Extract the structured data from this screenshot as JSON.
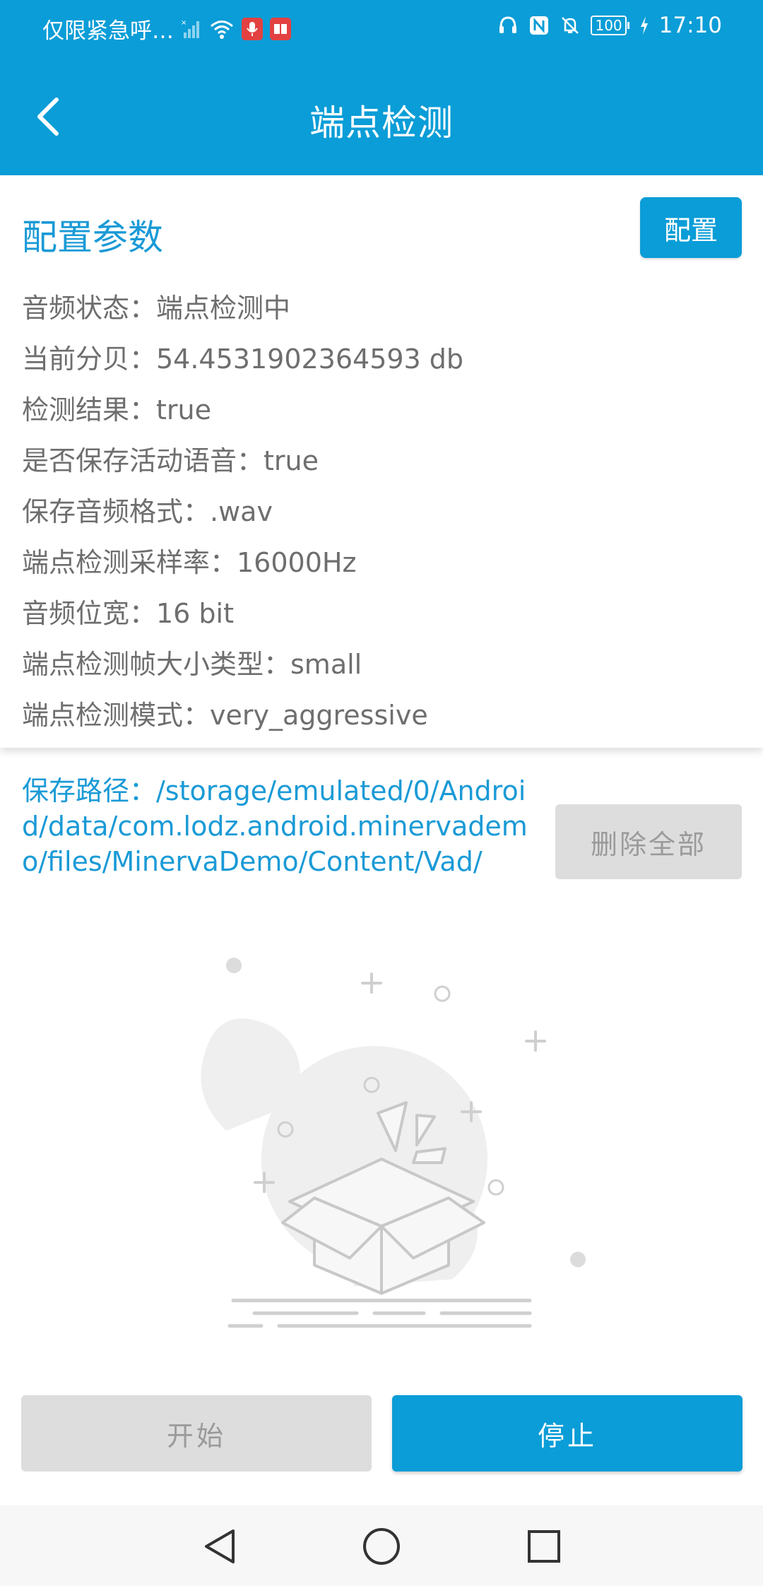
{
  "status_bar": {
    "carrier": "仅限紧急呼…",
    "battery": "100",
    "time": "17:10",
    "icons": [
      "signal-icon",
      "wifi-icon",
      "microphone-icon",
      "book-icon",
      "headset-icon",
      "nfc-icon",
      "mute-bell-icon",
      "battery-icon",
      "charging-icon"
    ]
  },
  "app_bar": {
    "title": "端点检测",
    "back_icon": "back-arrow-icon"
  },
  "config": {
    "section_title": "配置参数",
    "config_button": "配置",
    "params": [
      {
        "text": "音频状态：端点检测中"
      },
      {
        "text": "当前分贝：54.4531902364593 db"
      },
      {
        "text": "检测结果：true"
      },
      {
        "text": "是否保存活动语音：true"
      },
      {
        "text": "保存音频格式：.wav"
      },
      {
        "text": "端点检测采样率：16000Hz"
      },
      {
        "text": "音频位宽：16 bit"
      },
      {
        "text": "端点检测帧大小类型：small"
      },
      {
        "text": "端点检测模式：very_aggressive"
      }
    ]
  },
  "storage": {
    "path": "保存路径：/storage/emulated/0/Android/data/com.lodz.android.minervademo/files/MinervaDemo/Content/Vad/",
    "delete_all_button": "删除全部"
  },
  "empty_state": {
    "icon": "empty-box-icon"
  },
  "actions": {
    "start_button": "开始",
    "stop_button": "停止"
  },
  "nav_bar": {
    "icons": [
      "nav-back-icon",
      "nav-home-icon",
      "nav-recents-icon"
    ]
  },
  "colors": {
    "primary": "#0a9dd7",
    "disabled_bg": "#dddddd",
    "disabled_text": "#9a9a9a",
    "param_text": "#6e6e6e"
  }
}
